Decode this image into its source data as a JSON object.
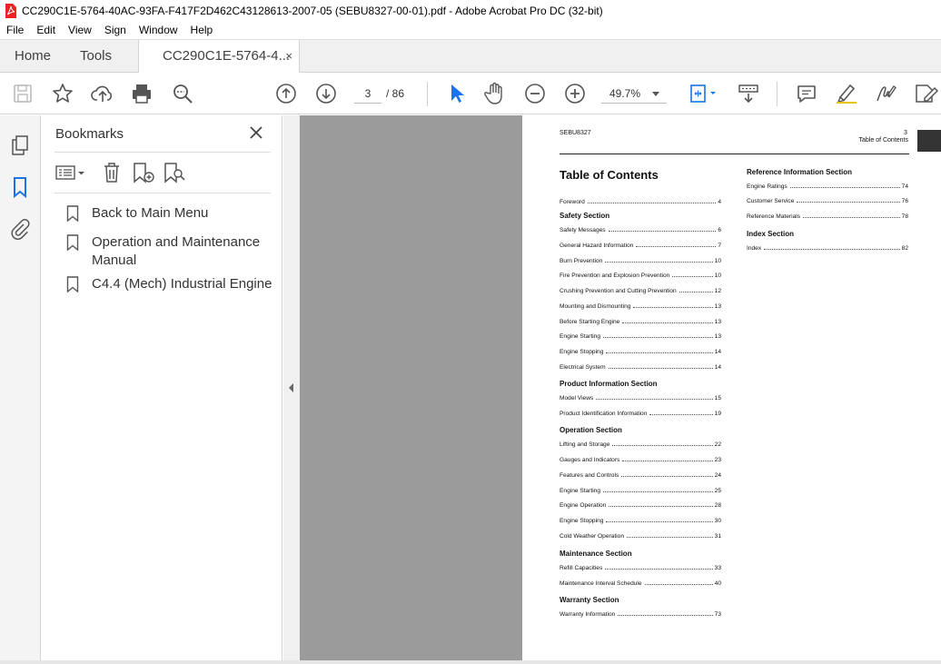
{
  "window": {
    "title": "CC290C1E-5764-40AC-93FA-F417F2D462C43128613-2007-05 (SEBU8327-00-01).pdf - Adobe Acrobat Pro DC (32-bit)"
  },
  "menu": [
    "File",
    "Edit",
    "View",
    "Sign",
    "Window",
    "Help"
  ],
  "tabs": {
    "home": "Home",
    "tools": "Tools",
    "document": "CC290C1E-5764-4...",
    "close": "×"
  },
  "toolbar": {
    "page_current": "3",
    "page_total": "/ 86",
    "zoom": "49.7%",
    "icons": [
      "save-icon",
      "star-icon",
      "upload-icon",
      "print-icon",
      "zoom-search-icon",
      "page-up-icon",
      "page-down-icon",
      "select-arrow-icon",
      "hand-icon",
      "zoom-out-icon",
      "zoom-in-icon",
      "fit-page-icon",
      "scroll-mode-icon",
      "comment-icon",
      "highlight-icon",
      "sign-icon",
      "edit-icon"
    ],
    "accent": "#1a73e8"
  },
  "bookmarks": {
    "title": "Bookmarks",
    "items": [
      {
        "label": "Back to Main Menu"
      },
      {
        "label": "Operation and Maintenance Manual"
      },
      {
        "label": "C4.4 (Mech) Industrial Engine"
      }
    ]
  },
  "document_page": {
    "header_left": "SEBU8327",
    "header_page": "3",
    "header_right": "Table of Contents",
    "toc_title": "Table of Contents",
    "left_column": [
      {
        "kind": "entry",
        "text": "Foreword",
        "page": "4"
      },
      {
        "kind": "section",
        "text": "Safety Section"
      },
      {
        "kind": "entry",
        "text": "Safety Messages",
        "page": "6"
      },
      {
        "kind": "entry",
        "text": "General Hazard Information",
        "page": "7"
      },
      {
        "kind": "entry",
        "text": "Burn Prevention",
        "page": "10"
      },
      {
        "kind": "entry",
        "text": "Fire Prevention and Explosion Prevention",
        "page": "10"
      },
      {
        "kind": "entry",
        "text": "Crushing Prevention and Cutting Prevention",
        "page": "12"
      },
      {
        "kind": "entry",
        "text": "Mounting and Dismounting",
        "page": "13"
      },
      {
        "kind": "entry",
        "text": "Before Starting Engine",
        "page": "13"
      },
      {
        "kind": "entry",
        "text": "Engine Starting",
        "page": "13"
      },
      {
        "kind": "entry",
        "text": "Engine Stopping",
        "page": "14"
      },
      {
        "kind": "entry",
        "text": "Electrical System",
        "page": "14"
      },
      {
        "kind": "section",
        "text": "Product Information Section"
      },
      {
        "kind": "entry",
        "text": "Model Views",
        "page": "15"
      },
      {
        "kind": "entry",
        "text": "Product Identification Information",
        "page": "19"
      },
      {
        "kind": "section",
        "text": "Operation Section"
      },
      {
        "kind": "entry",
        "text": "Lifting and Storage",
        "page": "22"
      },
      {
        "kind": "entry",
        "text": "Gauges and Indicators",
        "page": "23"
      },
      {
        "kind": "entry",
        "text": "Features and Controls",
        "page": "24"
      },
      {
        "kind": "entry",
        "text": "Engine Starting",
        "page": "25"
      },
      {
        "kind": "entry",
        "text": "Engine Operation",
        "page": "28"
      },
      {
        "kind": "entry",
        "text": "Engine Stopping",
        "page": "30"
      },
      {
        "kind": "entry",
        "text": "Cold Weather Operation",
        "page": "31"
      },
      {
        "kind": "section",
        "text": "Maintenance Section"
      },
      {
        "kind": "entry",
        "text": "Refill Capacities",
        "page": "33"
      },
      {
        "kind": "entry",
        "text": "Maintenance Interval Schedule",
        "page": "40"
      },
      {
        "kind": "section",
        "text": "Warranty Section"
      },
      {
        "kind": "entry",
        "text": "Warranty Information",
        "page": "73"
      }
    ],
    "right_column": [
      {
        "kind": "section",
        "text": "Reference Information Section"
      },
      {
        "kind": "entry",
        "text": "Engine Ratings",
        "page": "74"
      },
      {
        "kind": "entry",
        "text": "Customer Service",
        "page": "76"
      },
      {
        "kind": "entry",
        "text": "Reference Materials",
        "page": "78"
      },
      {
        "kind": "section",
        "text": "Index Section"
      },
      {
        "kind": "entry",
        "text": "Index",
        "page": "82"
      }
    ]
  }
}
